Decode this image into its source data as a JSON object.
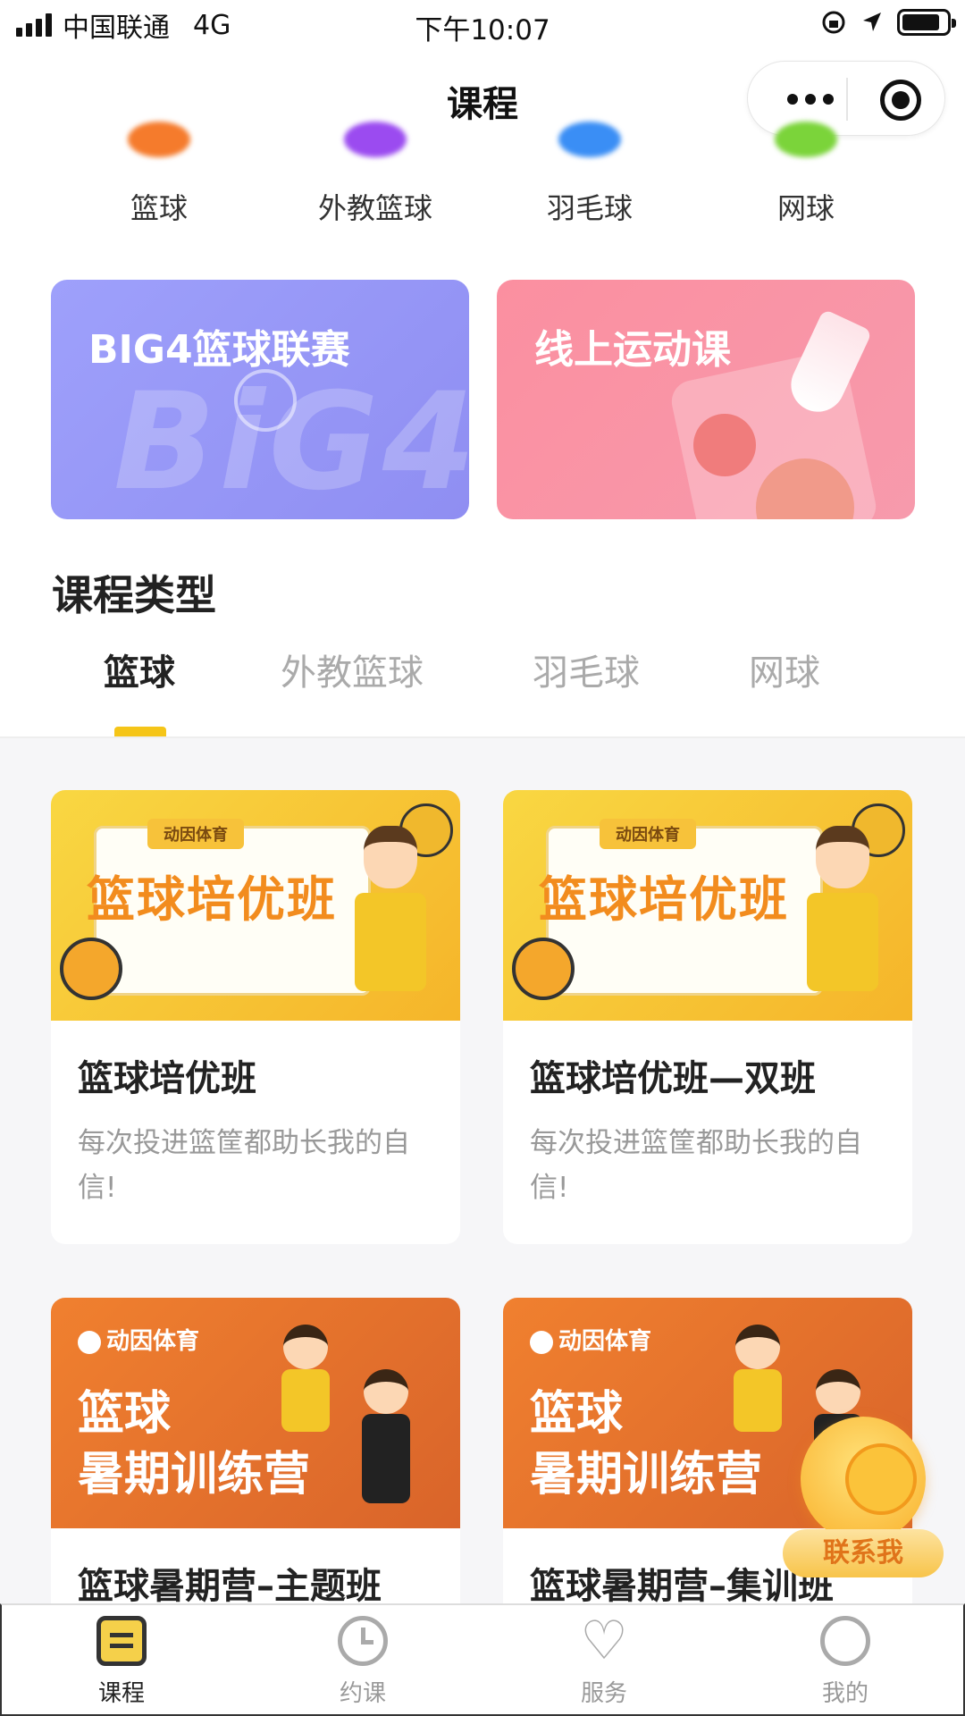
{
  "status_bar": {
    "carrier": "中国联通",
    "network": "4G",
    "time": "下午10:07",
    "battery_level": 0.85
  },
  "nav": {
    "title": "课程"
  },
  "categories": [
    {
      "label": "篮球",
      "color": "#f57b2c"
    },
    {
      "label": "外教篮球",
      "color": "#9b4bf0"
    },
    {
      "label": "羽毛球",
      "color": "#3a8ef5"
    },
    {
      "label": "网球",
      "color": "#7bd43a"
    }
  ],
  "banners": [
    {
      "title": "BIG4篮球联赛"
    },
    {
      "title": "线上运动课"
    }
  ],
  "section": {
    "title": "课程类型"
  },
  "tabs": [
    "篮球",
    "外教篮球",
    "羽毛球",
    "网球"
  ],
  "cards": [
    {
      "brand": "动因体育",
      "image_text": "篮球培优班",
      "title": "篮球培优班",
      "desc": "每次投进篮筐都助长我的自信!"
    },
    {
      "brand": "动因体育",
      "image_text": "篮球培优班",
      "title": "篮球培优班—双班",
      "desc": "每次投进篮筐都助长我的自信!"
    },
    {
      "brand": "动因体育",
      "image_text_line1": "篮球",
      "image_text_line2": "暑期训练营",
      "title": "篮球暑期营–主题班"
    },
    {
      "brand": "动因体育",
      "image_text_line1": "篮球",
      "image_text_line2": "暑期训练营",
      "title": "篮球暑期营–集训班"
    }
  ],
  "contact": {
    "label": "联系我"
  },
  "tabbar": [
    {
      "label": "课程",
      "icon": "course-icon"
    },
    {
      "label": "约课",
      "icon": "clock-icon"
    },
    {
      "label": "服务",
      "icon": "heart-icon"
    },
    {
      "label": "我的",
      "icon": "user-icon"
    }
  ]
}
